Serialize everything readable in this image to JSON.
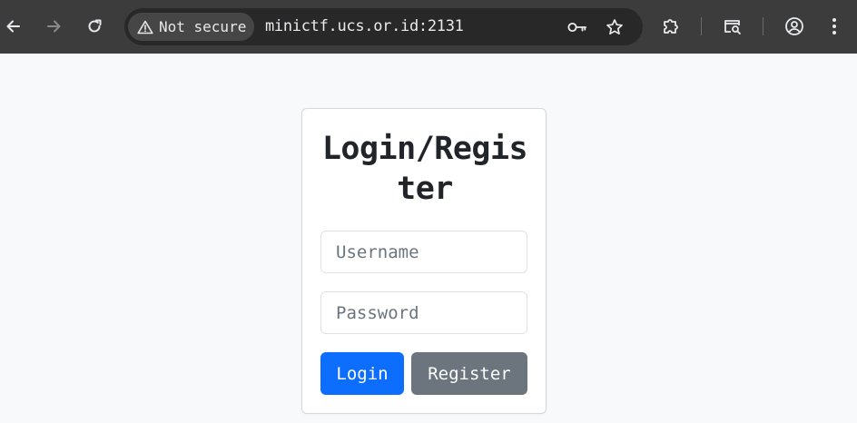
{
  "browser": {
    "security_chip": "Not secure",
    "url": "minictf.ucs.or.id:2131"
  },
  "login_card": {
    "title": "Login/Register",
    "username_placeholder": "Username",
    "password_placeholder": "Password",
    "login_label": "Login",
    "register_label": "Register"
  },
  "colors": {
    "primary": "#0d6efd",
    "secondary": "#6c757d",
    "page_bg": "#f8f9fa",
    "toolbar_bg": "#3c3c3c"
  }
}
